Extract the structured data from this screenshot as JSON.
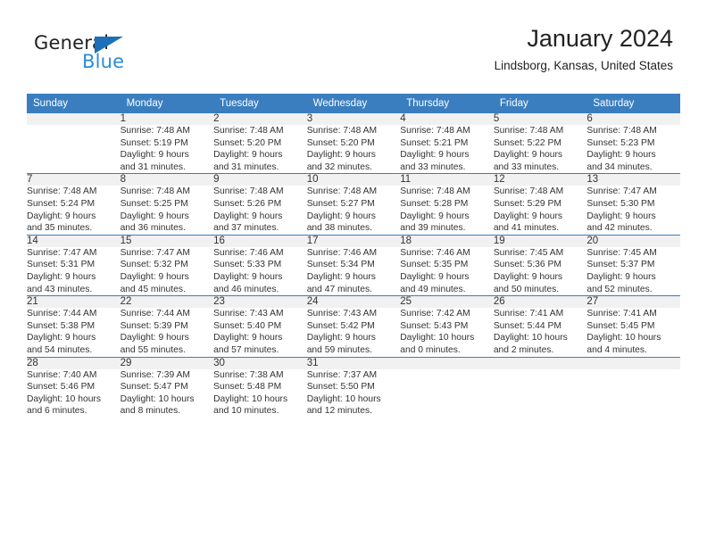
{
  "brand": {
    "name_part1": "General",
    "name_part2": "Blue",
    "accent_color": "#1d70b8",
    "accent_color_light": "#2b8cd9"
  },
  "header": {
    "title": "January 2024",
    "subtitle": "Lindsborg, Kansas, United States"
  },
  "theme": {
    "header_bar_color": "#3a7ec0",
    "daynum_band_color": "#f1f1f1",
    "separator_color": "#3a7ec0"
  },
  "calendar": {
    "weekday_headers": [
      "Sunday",
      "Monday",
      "Tuesday",
      "Wednesday",
      "Thursday",
      "Friday",
      "Saturday"
    ],
    "weeks": [
      [
        {
          "day": "",
          "sunrise": "",
          "sunset": "",
          "daylight_line1": "",
          "daylight_line2": ""
        },
        {
          "day": "1",
          "sunrise": "Sunrise: 7:48 AM",
          "sunset": "Sunset: 5:19 PM",
          "daylight_line1": "Daylight: 9 hours",
          "daylight_line2": "and 31 minutes."
        },
        {
          "day": "2",
          "sunrise": "Sunrise: 7:48 AM",
          "sunset": "Sunset: 5:20 PM",
          "daylight_line1": "Daylight: 9 hours",
          "daylight_line2": "and 31 minutes."
        },
        {
          "day": "3",
          "sunrise": "Sunrise: 7:48 AM",
          "sunset": "Sunset: 5:20 PM",
          "daylight_line1": "Daylight: 9 hours",
          "daylight_line2": "and 32 minutes."
        },
        {
          "day": "4",
          "sunrise": "Sunrise: 7:48 AM",
          "sunset": "Sunset: 5:21 PM",
          "daylight_line1": "Daylight: 9 hours",
          "daylight_line2": "and 33 minutes."
        },
        {
          "day": "5",
          "sunrise": "Sunrise: 7:48 AM",
          "sunset": "Sunset: 5:22 PM",
          "daylight_line1": "Daylight: 9 hours",
          "daylight_line2": "and 33 minutes."
        },
        {
          "day": "6",
          "sunrise": "Sunrise: 7:48 AM",
          "sunset": "Sunset: 5:23 PM",
          "daylight_line1": "Daylight: 9 hours",
          "daylight_line2": "and 34 minutes."
        }
      ],
      [
        {
          "day": "7",
          "sunrise": "Sunrise: 7:48 AM",
          "sunset": "Sunset: 5:24 PM",
          "daylight_line1": "Daylight: 9 hours",
          "daylight_line2": "and 35 minutes."
        },
        {
          "day": "8",
          "sunrise": "Sunrise: 7:48 AM",
          "sunset": "Sunset: 5:25 PM",
          "daylight_line1": "Daylight: 9 hours",
          "daylight_line2": "and 36 minutes."
        },
        {
          "day": "9",
          "sunrise": "Sunrise: 7:48 AM",
          "sunset": "Sunset: 5:26 PM",
          "daylight_line1": "Daylight: 9 hours",
          "daylight_line2": "and 37 minutes."
        },
        {
          "day": "10",
          "sunrise": "Sunrise: 7:48 AM",
          "sunset": "Sunset: 5:27 PM",
          "daylight_line1": "Daylight: 9 hours",
          "daylight_line2": "and 38 minutes."
        },
        {
          "day": "11",
          "sunrise": "Sunrise: 7:48 AM",
          "sunset": "Sunset: 5:28 PM",
          "daylight_line1": "Daylight: 9 hours",
          "daylight_line2": "and 39 minutes."
        },
        {
          "day": "12",
          "sunrise": "Sunrise: 7:48 AM",
          "sunset": "Sunset: 5:29 PM",
          "daylight_line1": "Daylight: 9 hours",
          "daylight_line2": "and 41 minutes."
        },
        {
          "day": "13",
          "sunrise": "Sunrise: 7:47 AM",
          "sunset": "Sunset: 5:30 PM",
          "daylight_line1": "Daylight: 9 hours",
          "daylight_line2": "and 42 minutes."
        }
      ],
      [
        {
          "day": "14",
          "sunrise": "Sunrise: 7:47 AM",
          "sunset": "Sunset: 5:31 PM",
          "daylight_line1": "Daylight: 9 hours",
          "daylight_line2": "and 43 minutes."
        },
        {
          "day": "15",
          "sunrise": "Sunrise: 7:47 AM",
          "sunset": "Sunset: 5:32 PM",
          "daylight_line1": "Daylight: 9 hours",
          "daylight_line2": "and 45 minutes."
        },
        {
          "day": "16",
          "sunrise": "Sunrise: 7:46 AM",
          "sunset": "Sunset: 5:33 PM",
          "daylight_line1": "Daylight: 9 hours",
          "daylight_line2": "and 46 minutes."
        },
        {
          "day": "17",
          "sunrise": "Sunrise: 7:46 AM",
          "sunset": "Sunset: 5:34 PM",
          "daylight_line1": "Daylight: 9 hours",
          "daylight_line2": "and 47 minutes."
        },
        {
          "day": "18",
          "sunrise": "Sunrise: 7:46 AM",
          "sunset": "Sunset: 5:35 PM",
          "daylight_line1": "Daylight: 9 hours",
          "daylight_line2": "and 49 minutes."
        },
        {
          "day": "19",
          "sunrise": "Sunrise: 7:45 AM",
          "sunset": "Sunset: 5:36 PM",
          "daylight_line1": "Daylight: 9 hours",
          "daylight_line2": "and 50 minutes."
        },
        {
          "day": "20",
          "sunrise": "Sunrise: 7:45 AM",
          "sunset": "Sunset: 5:37 PM",
          "daylight_line1": "Daylight: 9 hours",
          "daylight_line2": "and 52 minutes."
        }
      ],
      [
        {
          "day": "21",
          "sunrise": "Sunrise: 7:44 AM",
          "sunset": "Sunset: 5:38 PM",
          "daylight_line1": "Daylight: 9 hours",
          "daylight_line2": "and 54 minutes."
        },
        {
          "day": "22",
          "sunrise": "Sunrise: 7:44 AM",
          "sunset": "Sunset: 5:39 PM",
          "daylight_line1": "Daylight: 9 hours",
          "daylight_line2": "and 55 minutes."
        },
        {
          "day": "23",
          "sunrise": "Sunrise: 7:43 AM",
          "sunset": "Sunset: 5:40 PM",
          "daylight_line1": "Daylight: 9 hours",
          "daylight_line2": "and 57 minutes."
        },
        {
          "day": "24",
          "sunrise": "Sunrise: 7:43 AM",
          "sunset": "Sunset: 5:42 PM",
          "daylight_line1": "Daylight: 9 hours",
          "daylight_line2": "and 59 minutes."
        },
        {
          "day": "25",
          "sunrise": "Sunrise: 7:42 AM",
          "sunset": "Sunset: 5:43 PM",
          "daylight_line1": "Daylight: 10 hours",
          "daylight_line2": "and 0 minutes."
        },
        {
          "day": "26",
          "sunrise": "Sunrise: 7:41 AM",
          "sunset": "Sunset: 5:44 PM",
          "daylight_line1": "Daylight: 10 hours",
          "daylight_line2": "and 2 minutes."
        },
        {
          "day": "27",
          "sunrise": "Sunrise: 7:41 AM",
          "sunset": "Sunset: 5:45 PM",
          "daylight_line1": "Daylight: 10 hours",
          "daylight_line2": "and 4 minutes."
        }
      ],
      [
        {
          "day": "28",
          "sunrise": "Sunrise: 7:40 AM",
          "sunset": "Sunset: 5:46 PM",
          "daylight_line1": "Daylight: 10 hours",
          "daylight_line2": "and 6 minutes."
        },
        {
          "day": "29",
          "sunrise": "Sunrise: 7:39 AM",
          "sunset": "Sunset: 5:47 PM",
          "daylight_line1": "Daylight: 10 hours",
          "daylight_line2": "and 8 minutes."
        },
        {
          "day": "30",
          "sunrise": "Sunrise: 7:38 AM",
          "sunset": "Sunset: 5:48 PM",
          "daylight_line1": "Daylight: 10 hours",
          "daylight_line2": "and 10 minutes."
        },
        {
          "day": "31",
          "sunrise": "Sunrise: 7:37 AM",
          "sunset": "Sunset: 5:50 PM",
          "daylight_line1": "Daylight: 10 hours",
          "daylight_line2": "and 12 minutes."
        },
        {
          "day": "",
          "sunrise": "",
          "sunset": "",
          "daylight_line1": "",
          "daylight_line2": ""
        },
        {
          "day": "",
          "sunrise": "",
          "sunset": "",
          "daylight_line1": "",
          "daylight_line2": ""
        },
        {
          "day": "",
          "sunrise": "",
          "sunset": "",
          "daylight_line1": "",
          "daylight_line2": ""
        }
      ]
    ]
  }
}
